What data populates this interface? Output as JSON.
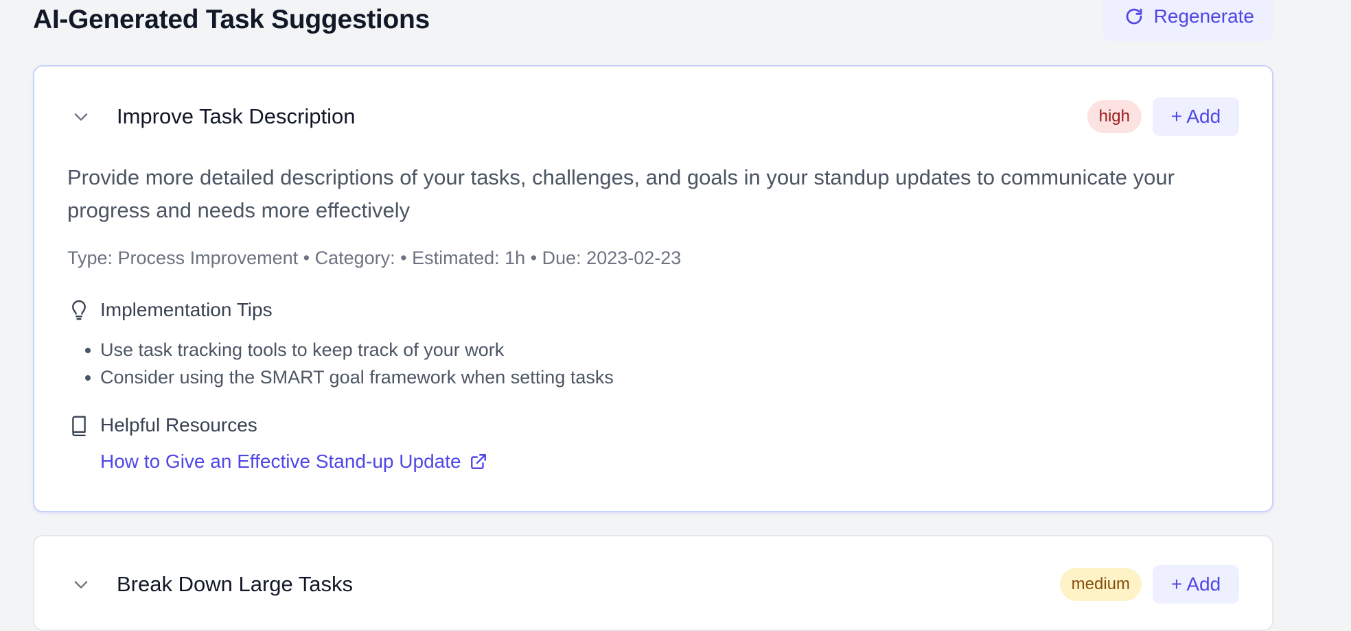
{
  "header": {
    "title": "AI-Generated Task Suggestions",
    "regenerate_label": "Regenerate",
    "regenerate_icon": "refresh-icon"
  },
  "colors": {
    "accent": "#4f46e5",
    "card_border": "#c7d2fe",
    "high_bg": "#fde2e2",
    "high_text": "#991b1b",
    "medium_bg": "#fef3c7",
    "medium_text": "#854d0e"
  },
  "suggestions": [
    {
      "title": "Improve Task Description",
      "priority": "high",
      "add_label": "+ Add",
      "description": "Provide more detailed descriptions of your tasks, challenges, and goals in your standup updates to communicate your progress and needs more effectively",
      "meta": "Type: Process Improvement • Category: • Estimated: 1h • Due: 2023-02-23",
      "tips_heading": "Implementation Tips",
      "tips": [
        "Use task tracking tools to keep track of your work",
        "Consider using the SMART goal framework when setting tasks"
      ],
      "resources_heading": "Helpful Resources",
      "resources": [
        {
          "label": "How to Give an Effective Stand-up Update",
          "icon": "external-link-icon"
        }
      ]
    },
    {
      "title": "Break Down Large Tasks",
      "priority": "medium",
      "add_label": "+ Add"
    }
  ]
}
